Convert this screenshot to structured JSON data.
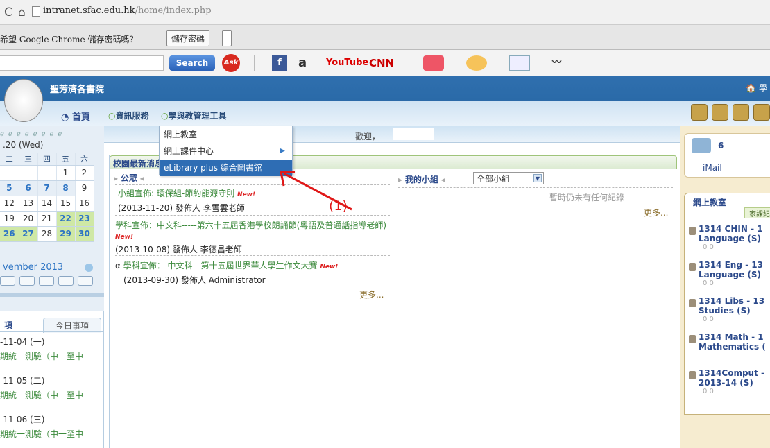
{
  "browser": {
    "url_host": "intranet.sfac.edu.hk",
    "url_path": "/home/index.php",
    "password_prompt": "希望 Google Chrome 儲存密碼嗎？",
    "save_password_button": "儲存密碼"
  },
  "toolbar": {
    "search_button": "Search",
    "ask_label": "Ask",
    "amazon_label": "a",
    "youtube_label": "YouTube",
    "cnn_label": "CNN"
  },
  "header": {
    "school_name": "聖芳濟各書院",
    "home_link": "🏠 學",
    "nav_home": "首頁",
    "nav_info": "資訊服務",
    "nav_tools": "學與教管理工具"
  },
  "welcome": {
    "text": "歡迎，"
  },
  "dropdown": {
    "items": [
      {
        "label": "網上教室"
      },
      {
        "label": "網上課件中心",
        "has_submenu": true
      },
      {
        "label": "eLibrary plus 綜合圖書館",
        "highlighted": true
      }
    ]
  },
  "annotation": {
    "label": "(1)"
  },
  "calendar": {
    "date_label": ".20 (Wed)",
    "weekday_headers": [
      "二",
      "三",
      "四",
      "五",
      "六"
    ],
    "rows": [
      [
        "",
        "",
        "",
        "1",
        "2"
      ],
      [
        "5",
        "6",
        "7",
        "8",
        "9"
      ],
      [
        "12",
        "13",
        "14",
        "15",
        "16"
      ],
      [
        "19",
        "20",
        "21",
        "22",
        "23"
      ],
      [
        "26",
        "27",
        "28",
        "29",
        "30"
      ]
    ],
    "month": "vember 2013"
  },
  "events": {
    "tab_current": "項",
    "tab_today": "今日事項",
    "items": [
      {
        "date": "-11-04 (一)",
        "title": "期統一測驗（中一至中"
      },
      {
        "date": "-11-05 (二)",
        "title": "期統一測驗（中一至中"
      },
      {
        "date": "-11-06 (三)",
        "title": "期統一測驗（中一至中"
      }
    ]
  },
  "news": {
    "tab_title": "校園最新消息",
    "announcements_label": "公眾",
    "my_groups_label": "我的小組",
    "group_select": "全部小組",
    "no_records": "暫時仍未有任何紀錄",
    "more": "更多...",
    "items": [
      {
        "title": "小組宣佈: 環保組-節約能源守則",
        "new": "New!",
        "meta": "(2013-11-20) 發佈人 李雪雲老師"
      },
      {
        "title": "學科宣佈：中文科-----第六十五屆香港學校朗誦節(粵語及普通話指導老師)",
        "new": "New!",
        "meta": "(2013-10-08) 發佈人 李德昌老師"
      },
      {
        "title": "學科宣佈： 中文科 - 第十五屆世界華人學生作文大賽",
        "new": "New!",
        "meta": "(2013-09-30) 發佈人 Administrator"
      }
    ]
  },
  "right_panel": {
    "imail_count": "6",
    "imail_label": "iMail",
    "classroom_title": "網上教室",
    "classroom_tab": "家課紀",
    "courses": [
      {
        "line1": "1314 CHIN - 1",
        "line2": "Language (S)",
        "stats": "0  0"
      },
      {
        "line1": "1314 Eng - 13",
        "line2": "Language (S)",
        "stats": "0  0"
      },
      {
        "line1": "1314 Libs - 13",
        "line2": "Studies (S)",
        "stats": "0  0"
      },
      {
        "line1": "1314 Math - 1",
        "line2": "Mathematics (",
        "stats": "0  0"
      },
      {
        "line1": "1314Comput -",
        "line2": "2013-14 (S)",
        "stats": "0  0"
      }
    ]
  }
}
